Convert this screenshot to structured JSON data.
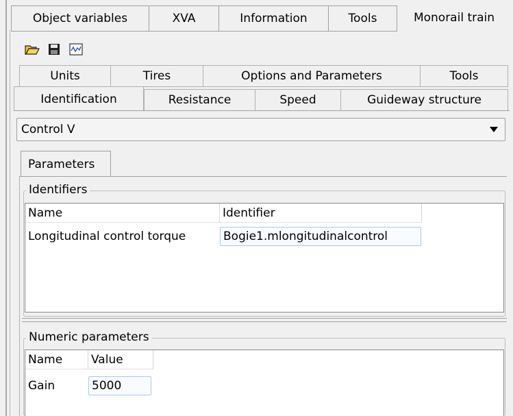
{
  "top_tabs": [
    "Object variables",
    "XVA",
    "Information",
    "Tools",
    "Monorail train"
  ],
  "toolbar": {
    "icons": [
      "open-folder-icon",
      "save-icon",
      "chart-icon"
    ]
  },
  "subtabs_row1": [
    "Units",
    "Tires",
    "Options and Parameters",
    "Tools"
  ],
  "subtabs_row2": [
    "Identification",
    "Resistance",
    "Speed",
    "Guideway structure"
  ],
  "dropdown": {
    "selected": "Control V"
  },
  "parameters_tab": "Parameters",
  "identifiers": {
    "legend": "Identifiers",
    "columns": [
      "Name",
      "Identifier"
    ],
    "rows": [
      [
        "Longitudinal control torque",
        "Bogie1.mlongitudinalcontrol"
      ]
    ]
  },
  "numeric": {
    "legend": "Numeric parameters",
    "columns": [
      "Name",
      "Value"
    ],
    "rows": [
      [
        "Gain",
        "5000"
      ]
    ]
  }
}
